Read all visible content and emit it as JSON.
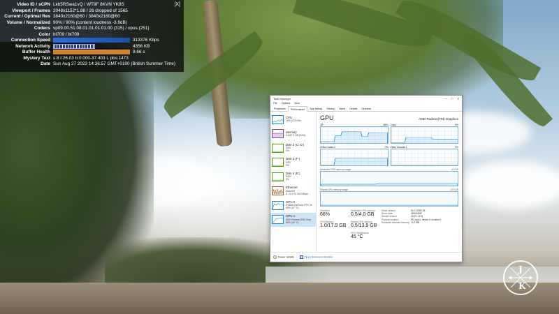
{
  "stats_overlay": {
    "close_label": "[X]",
    "rows": [
      {
        "label": "Video ID / sCPN",
        "value": "Lkb5RSwa1vQ / WT8F 8KVN YK8S"
      },
      {
        "label": "Viewport / Frames",
        "value": "2048x1152*1.88 / 26 dropped of 1565"
      },
      {
        "label": "Current / Optimal Res",
        "value": "3840x2160@60 / 3840x2160@60"
      },
      {
        "label": "Volume / Normalized",
        "value": "90% / 90% (content loudness -3.9dB)"
      },
      {
        "label": "Codecs",
        "value": "vp09.00.51.08.01.01.01.01.00 (315) / opus (251)"
      },
      {
        "label": "Color",
        "value": "bt709 / bt709"
      },
      {
        "label": "Connection Speed",
        "value": "313376 Kbps"
      },
      {
        "label": "Network Activity",
        "value": "4356 KB"
      },
      {
        "label": "Buffer Health",
        "value": "9.66 s"
      },
      {
        "label": "Mystery Text",
        "value": "s:8 t:26.03 b:0.000-37.403 L pbs:1473"
      },
      {
        "label": "Date",
        "value": "Sun Aug 27 2023 14:36:57 GMT+0100 (British Summer Time)"
      }
    ]
  },
  "task_manager": {
    "title": "Task Manager",
    "window_controls": [
      "–",
      "□",
      "×"
    ],
    "menu": [
      "File",
      "Options",
      "View"
    ],
    "tabs": [
      "Processes",
      "Performance",
      "App history",
      "Startup",
      "Users",
      "Details",
      "Services"
    ],
    "active_tab": "Performance",
    "sidebar": [
      {
        "name": "CPU",
        "sub": "19% 4.23 GHz",
        "color": "#1a8cd8",
        "icon": "cpu-graph-icon"
      },
      {
        "name": "Memory",
        "sub": "9.6/27.9 GB (34%)",
        "color": "#8b3fa8",
        "icon": "memory-graph-icon"
      },
      {
        "name": "Disk 2 (C: D:)",
        "sub": "SSD\n0%",
        "color": "#4da60c",
        "icon": "disk-graph-icon"
      },
      {
        "name": "Disk 3 (F:)",
        "sub": "SSD\n0%",
        "color": "#4da60c",
        "icon": "disk-graph-icon"
      },
      {
        "name": "Disk 4 (E:)",
        "sub": "SSD\n0%",
        "color": "#4da60c",
        "icon": "disk-graph-icon"
      },
      {
        "name": "Ethernet",
        "sub": "Ethernet\nS: 24.0  R: 16.0 Mbps",
        "color": "#a7642b",
        "icon": "ethernet-graph-icon"
      },
      {
        "name": "GPU 0",
        "sub": "NVIDIA GeForce RTX 30\n40% (47 °C)",
        "color": "#1a8cd8",
        "icon": "gpu-graph-icon"
      },
      {
        "name": "GPU 1",
        "sub": "AMD Radeon(TM) Grap\n66% (45 °C)",
        "color": "#1a8cd8",
        "icon": "gpu-graph-icon"
      }
    ],
    "selected_index": 7,
    "gpu": {
      "title": "GPU",
      "name": "AMD Radeon(TM) Graphics",
      "graphs": [
        {
          "label": "3D",
          "right": "66%"
        },
        {
          "label": "Copy",
          "right": "0%"
        },
        {
          "label": "Video Codec 0",
          "right": "0%"
        },
        {
          "label": "Video Decode 1",
          "right": "0%"
        }
      ],
      "wide_graphs": [
        {
          "label": "Dedicated GPU memory usage",
          "right": "4.0 GB"
        },
        {
          "label": "Shared GPU memory usage",
          "right": "13.9 GB"
        }
      ],
      "stats": [
        {
          "label": "Utilization",
          "value": "66%"
        },
        {
          "label": "Dedicated GPU memory",
          "value": "0.5/4.0 GB"
        },
        {
          "label": "GPU Memory",
          "value": "1.0/17.9 GB"
        },
        {
          "label": "Shared GPU memory",
          "value": "0.5/13.9 GB"
        },
        {
          "label": "GPU Temperature",
          "value": "45 °C"
        }
      ],
      "details": [
        {
          "k": "Driver version:",
          "v": "31.0.12002.92"
        },
        {
          "k": "Driver date:",
          "v": "22/06/2022"
        },
        {
          "k": "DirectX version:",
          "v": "12 (FL 12.1)"
        },
        {
          "k": "Physical location:",
          "v": "PCI bus 4, device 0, function 0"
        },
        {
          "k": "Hardware reserved memory:",
          "v": "74.2 MB"
        }
      ]
    },
    "footer": {
      "fewer_details": "Fewer details",
      "open_rm": "Open Resource Monitor"
    }
  },
  "watermark": {
    "letters": [
      "J",
      "K"
    ]
  }
}
